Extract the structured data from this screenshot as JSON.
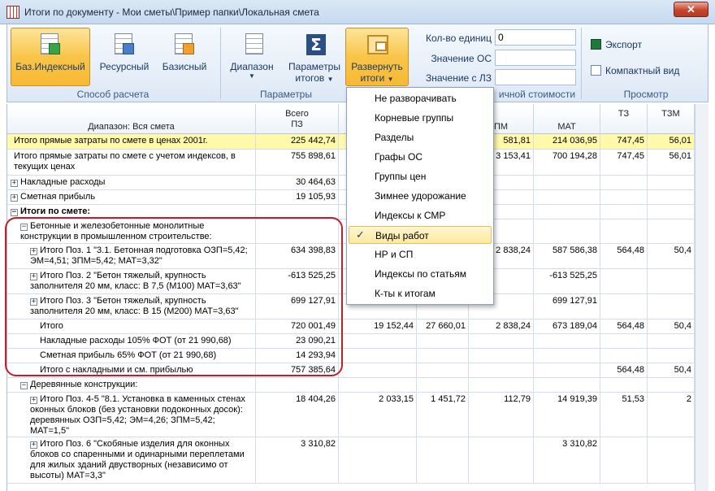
{
  "window": {
    "title": "Итоги по документу - Мои сметы\\Пример папки\\Локальная смета",
    "close_label": "✕"
  },
  "ribbon": {
    "calc_group": {
      "label": "Способ расчета",
      "buttons": [
        {
          "label": "Баз.Индексный",
          "active": true
        },
        {
          "label": "Ресурсный",
          "active": false
        },
        {
          "label": "Базисный",
          "active": false
        }
      ]
    },
    "params_group": {
      "label": "Параметры",
      "range_label": "Диапазон",
      "params_label_1": "Параметры",
      "params_label_2": "итогов",
      "expand_label_1": "Развернуть",
      "expand_label_2": "итоги"
    },
    "fields": {
      "units_label": "Кол-во единиц",
      "units_value": "0",
      "os_label": "Значение ОС",
      "os_value": "",
      "lz_label": "Значение с ЛЗ",
      "lz_value": ""
    },
    "fields_group_label": "ичной стоимости",
    "view_group": {
      "label": "Просмотр",
      "export_label": "Экспорт",
      "compact_label": "Компактный вид"
    }
  },
  "grid": {
    "range_header": "Диапазон: Вся смета",
    "col_total_1": "Всего",
    "col_total_2": "ПЗ",
    "col_pm": "ПМ",
    "col_mat": "МАТ",
    "col_tz": "ТЗ",
    "col_tzm": "ТЗМ",
    "rows": [
      {
        "name": "Итого прямые затраты по смете в ценах 2001г.",
        "total": "225 442,74",
        "c3": "",
        "c4": "",
        "pm": "581,81",
        "mat": "214 036,95",
        "tz": "747,45",
        "tzm": "56,01"
      },
      {
        "name": "Итого прямые затраты по смете с учетом индексов, в текущих ценах",
        "total": "755 898,61",
        "c3": "",
        "c4": "",
        "pm": "3 153,41",
        "mat": "700 194,28",
        "tz": "747,45",
        "tzm": "56,01"
      },
      {
        "name": "Накладные расходы",
        "total": "30 464,63",
        "c3": "",
        "c4": "",
        "pm": "",
        "mat": "",
        "tz": "",
        "tzm": ""
      },
      {
        "name": "Сметная прибыль",
        "total": "19 105,93",
        "c3": "",
        "c4": "",
        "pm": "",
        "mat": "",
        "tz": "",
        "tzm": ""
      },
      {
        "name": "Итоги по смете:",
        "total": "",
        "c3": "",
        "c4": "",
        "pm": "",
        "mat": "",
        "tz": "",
        "tzm": ""
      },
      {
        "name": "Бетонные и железобетонные монолитные конструкции в промышленном строительстве:",
        "total": "",
        "c3": "",
        "c4": "",
        "pm": "",
        "mat": "",
        "tz": "",
        "tzm": ""
      },
      {
        "name": "Итого Поз. 1 \"3.1. Бетонная подготовка ОЗП=5,42; ЭМ=4,51; ЗПМ=5,42; МАТ=3,32\"",
        "total": "634 398,83",
        "c3": "",
        "c4": "",
        "pm": "2 838,24",
        "mat": "587 586,38",
        "tz": "564,48",
        "tzm": "50,4"
      },
      {
        "name": "Итого Поз. 2 \"Бетон тяжелый, крупность заполнителя 20 мм, класс: В 7,5 (М100) МАТ=3,63\"",
        "total": "-613 525,25",
        "c3": "",
        "c4": "",
        "pm": "",
        "mat": "-613 525,25",
        "tz": "",
        "tzm": ""
      },
      {
        "name": "Итого Поз. 3 \"Бетон тяжелый, крупность заполнителя 20 мм, класс: В 15 (М200) МАТ=3,63\"",
        "total": "699 127,91",
        "c3": "",
        "c4": "",
        "pm": "",
        "mat": "699 127,91",
        "tz": "",
        "tzm": ""
      },
      {
        "name": "Итого",
        "total": "720 001,49",
        "c3": "19 152,44",
        "c4": "27 660,01",
        "pm": "2 838,24",
        "mat": "673 189,04",
        "tz": "564,48",
        "tzm": "50,4"
      },
      {
        "name": "Накладные расходы 105% ФОТ (от 21 990,68)",
        "total": "23 090,21",
        "c3": "",
        "c4": "",
        "pm": "",
        "mat": "",
        "tz": "",
        "tzm": ""
      },
      {
        "name": "Сметная прибыль 65% ФОТ (от 21 990,68)",
        "total": "14 293,94",
        "c3": "",
        "c4": "",
        "pm": "",
        "mat": "",
        "tz": "",
        "tzm": ""
      },
      {
        "name": "Итого с накладными и см. прибылью",
        "total": "757 385,64",
        "c3": "",
        "c4": "",
        "pm": "",
        "mat": "",
        "tz": "564,48",
        "tzm": "50,4"
      },
      {
        "name": "Деревянные конструкции:",
        "total": "",
        "c3": "",
        "c4": "",
        "pm": "",
        "mat": "",
        "tz": "",
        "tzm": ""
      },
      {
        "name": "Итого Поз. 4-5 \"8.1. Установка в каменных стенах оконных блоков (без установки подоконных досок): деревянных ОЗП=5,42; ЭМ=4,26; ЗПМ=5,42; МАТ=1,5\"",
        "total": "18 404,26",
        "c3": "2 033,15",
        "c4": "1 451,72",
        "pm": "112,79",
        "mat": "14 919,39",
        "tz": "51,53",
        "tzm": "2"
      },
      {
        "name": "Итого Поз. 6 \"Скобяные изделия для оконных блоков со спаренными и одинарными переплетами для жилых зданий двустворных (независимо от высоты) МАТ=3,3\"",
        "total": "3 310,82",
        "c3": "",
        "c4": "",
        "pm": "",
        "mat": "3 310,82",
        "tz": "",
        "tzm": ""
      }
    ]
  },
  "dropdown": {
    "items": [
      {
        "label": "Не разворачивать",
        "checked": false
      },
      {
        "label": "Корневые группы",
        "checked": false
      },
      {
        "label": "Разделы",
        "checked": false
      },
      {
        "label": "Графы ОС",
        "checked": false
      },
      {
        "label": "Группы цен",
        "checked": false
      },
      {
        "label": "Зимнее удорожание",
        "checked": false
      },
      {
        "label": "Индексы к СМР",
        "checked": false
      },
      {
        "label": "Виды работ",
        "checked": true
      },
      {
        "label": "НР и СП",
        "checked": false
      },
      {
        "label": "Индексы по статьям",
        "checked": false
      },
      {
        "label": "К-ты к итогам",
        "checked": false
      }
    ],
    "check_glyph": "✓"
  },
  "colors": {
    "accent": "#f9c548",
    "highlight_frame": "#c0202c",
    "yellow_row": "#fff9a8"
  }
}
